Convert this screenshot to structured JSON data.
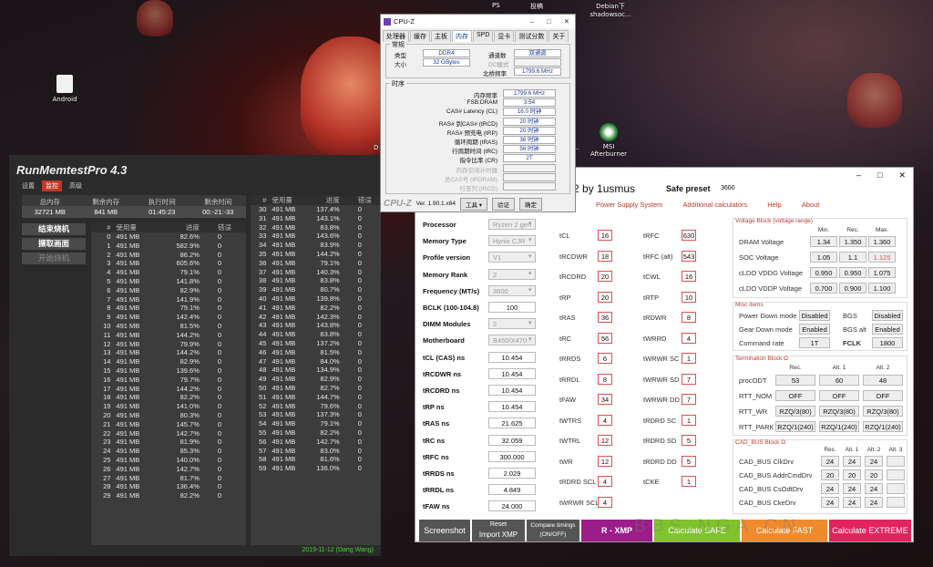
{
  "desktop": {
    "top_labels": [
      "PS",
      "投稿",
      "Debian下\nshadowsoc..."
    ],
    "icons": [
      {
        "label": "Android",
        "icon": "folder-icon"
      },
      {
        "label": "MSI\nAfterburner",
        "icon": "msi-icon"
      },
      {
        "label": "D",
        "icon": "app-icon"
      },
      {
        "label": "2...",
        "icon": "app-icon"
      }
    ]
  },
  "rmt": {
    "title": "RunMemtestPro 4.3",
    "menu": [
      "设置",
      "监控",
      "高级"
    ],
    "summary_headers": [
      "总内存",
      "剩余内存",
      "执行时间",
      "剩余时间"
    ],
    "summary_values": [
      "32721 MB",
      "841 MB",
      "01:45:23",
      "00:-21:-33"
    ],
    "buttons": [
      "结束烧机",
      "撷取画面",
      "开始烧机"
    ],
    "col_headers": [
      "#",
      "使用量",
      "进度",
      "错误"
    ],
    "left_rows": [
      [
        "0",
        "491 MB",
        "82.6%",
        "0"
      ],
      [
        "1",
        "491 MB",
        "582.9%",
        "0"
      ],
      [
        "2",
        "491 MB",
        "86.2%",
        "0"
      ],
      [
        "3",
        "491 MB",
        "605.6%",
        "0"
      ],
      [
        "4",
        "491 MB",
        "79.1%",
        "0"
      ],
      [
        "5",
        "491 MB",
        "141.8%",
        "0"
      ],
      [
        "6",
        "491 MB",
        "82.9%",
        "0"
      ],
      [
        "7",
        "491 MB",
        "141.9%",
        "0"
      ],
      [
        "8",
        "491 MB",
        "79.1%",
        "0"
      ],
      [
        "9",
        "491 MB",
        "142.4%",
        "0"
      ],
      [
        "10",
        "491 MB",
        "81.5%",
        "0"
      ],
      [
        "11",
        "491 MB",
        "144.2%",
        "0"
      ],
      [
        "12",
        "491 MB",
        "79.9%",
        "0"
      ],
      [
        "13",
        "491 MB",
        "144.2%",
        "0"
      ],
      [
        "14",
        "491 MB",
        "82.9%",
        "0"
      ],
      [
        "15",
        "491 MB",
        "139.6%",
        "0"
      ],
      [
        "16",
        "491 MB",
        "79.7%",
        "0"
      ],
      [
        "17",
        "491 MB",
        "144.2%",
        "0"
      ],
      [
        "18",
        "491 MB",
        "82.2%",
        "0"
      ],
      [
        "19",
        "491 MB",
        "141.0%",
        "0"
      ],
      [
        "20",
        "491 MB",
        "80.3%",
        "0"
      ],
      [
        "21",
        "491 MB",
        "145.7%",
        "0"
      ],
      [
        "22",
        "491 MB",
        "142.7%",
        "0"
      ],
      [
        "23",
        "491 MB",
        "81.9%",
        "0"
      ],
      [
        "24",
        "491 MB",
        "85.3%",
        "0"
      ],
      [
        "25",
        "491 MB",
        "140.0%",
        "0"
      ],
      [
        "26",
        "491 MB",
        "142.7%",
        "0"
      ],
      [
        "27",
        "491 MB",
        "81.7%",
        "0"
      ],
      [
        "28",
        "491 MB",
        "136.4%",
        "0"
      ],
      [
        "29",
        "491 MB",
        "82.2%",
        "0"
      ]
    ],
    "right_rows": [
      [
        "30",
        "491 MB",
        "137.4%",
        "0"
      ],
      [
        "31",
        "491 MB",
        "143.1%",
        "0"
      ],
      [
        "32",
        "491 MB",
        "83.8%",
        "0"
      ],
      [
        "33",
        "491 MB",
        "143.6%",
        "0"
      ],
      [
        "34",
        "491 MB",
        "83.9%",
        "0"
      ],
      [
        "35",
        "491 MB",
        "144.2%",
        "0"
      ],
      [
        "36",
        "491 MB",
        "79.1%",
        "0"
      ],
      [
        "37",
        "491 MB",
        "140.3%",
        "0"
      ],
      [
        "38",
        "491 MB",
        "83.8%",
        "0"
      ],
      [
        "39",
        "491 MB",
        "80.7%",
        "0"
      ],
      [
        "40",
        "491 MB",
        "139.8%",
        "0"
      ],
      [
        "41",
        "491 MB",
        "82.2%",
        "0"
      ],
      [
        "42",
        "491 MB",
        "142.3%",
        "0"
      ],
      [
        "43",
        "491 MB",
        "143.8%",
        "0"
      ],
      [
        "44",
        "491 MB",
        "83.8%",
        "0"
      ],
      [
        "45",
        "491 MB",
        "137.2%",
        "0"
      ],
      [
        "46",
        "491 MB",
        "81.5%",
        "0"
      ],
      [
        "47",
        "491 MB",
        "84.0%",
        "0"
      ],
      [
        "48",
        "491 MB",
        "134.9%",
        "0"
      ],
      [
        "49",
        "491 MB",
        "82.9%",
        "0"
      ],
      [
        "50",
        "491 MB",
        "82.7%",
        "0"
      ],
      [
        "51",
        "491 MB",
        "144.7%",
        "0"
      ],
      [
        "52",
        "491 MB",
        "79.6%",
        "0"
      ],
      [
        "53",
        "491 MB",
        "137.3%",
        "0"
      ],
      [
        "54",
        "491 MB",
        "79.1%",
        "0"
      ],
      [
        "55",
        "491 MB",
        "82.2%",
        "0"
      ],
      [
        "56",
        "491 MB",
        "142.7%",
        "0"
      ],
      [
        "57",
        "491 MB",
        "83.0%",
        "0"
      ],
      [
        "58",
        "491 MB",
        "81.6%",
        "0"
      ],
      [
        "59",
        "491 MB",
        "136.0%",
        "0"
      ]
    ],
    "date": "2019-11-12 (Dang Wang)"
  },
  "cpuz": {
    "title": "CPU-Z",
    "tabs": [
      "处理器",
      "缓存",
      "主板",
      "内存",
      "SPD",
      "显卡",
      "测试分数",
      "关于"
    ],
    "active_tab": "内存",
    "general_title": "常规",
    "type_label": "类型",
    "type": "DDR4",
    "size_label": "大小",
    "size": "32 GBytes",
    "channels_label": "通道数",
    "channels": "双通道",
    "dcmode_label": "DC模式",
    "dcmode": "",
    "nb_label": "北桥频率",
    "nb": "1799.6 MHz",
    "timing_title": "时序",
    "timings": [
      {
        "k": "内存频率",
        "v": "1799.6 MHz"
      },
      {
        "k": "FSB:DRAM",
        "v": "3:54"
      },
      {
        "k": "CAS# Latency (CL)",
        "v": "16.0 时钟"
      },
      {
        "k": "RAS# 到CAS# (tRCD)",
        "v": "20 时钟"
      },
      {
        "k": "RAS# 预充电 (tRP)",
        "v": "20 时钟"
      },
      {
        "k": "循环周期 (tRAS)",
        "v": "36 时钟"
      },
      {
        "k": "行周期时间 (tRC)",
        "v": "56 时钟"
      },
      {
        "k": "指令比率 (CR)",
        "v": "2T"
      },
      {
        "k": "内存空闲计时器",
        "v": ""
      },
      {
        "k": "总CAS号 (tRDRAM)",
        "v": ""
      },
      {
        "k": "行至列 (tRCD)",
        "v": ""
      }
    ],
    "footer": {
      "logo": "CPU-Z",
      "ver": "Ver. 1.90.1.x64",
      "tools": "工具",
      "validate": "验证",
      "ok": "确定"
    }
  },
  "dc": {
    "title": "6.2 by 1usmus",
    "safe_label": "Safe preset",
    "safe_value": "3600",
    "nav": [
      "Power Supply System",
      "Additional calculators",
      "Help",
      "About"
    ],
    "left_fields": [
      {
        "k": "Processor",
        "v": "Ryzen 2 gen",
        "g": true
      },
      {
        "k": "Memory Type",
        "v": "Hynix CJR",
        "g": true
      },
      {
        "k": "Profile version",
        "v": "V1",
        "g": true
      },
      {
        "k": "Memory Rank",
        "v": "2",
        "g": true
      },
      {
        "k": "Frequency (MT/s)",
        "v": "3600",
        "g": true
      },
      {
        "k": "BCLK (100-104.8)",
        "v": "100",
        "g": false
      },
      {
        "k": "DIMM Modules",
        "v": "2",
        "g": true
      },
      {
        "k": "Motherboard",
        "v": "B450/X470",
        "g": true
      },
      {
        "k": "tCL (CAS) ns",
        "v": "10.454",
        "g": false
      },
      {
        "k": "tRCDWR ns",
        "v": "10.454",
        "g": false
      },
      {
        "k": "tRCDRD ns",
        "v": "10.454",
        "g": false
      },
      {
        "k": "tRP ns",
        "v": "10.454",
        "g": false
      },
      {
        "k": "tRAS ns",
        "v": "21.625",
        "g": false
      },
      {
        "k": "tRC ns",
        "v": "32.059",
        "g": false
      },
      {
        "k": "tRFC ns",
        "v": "300.000",
        "g": false
      },
      {
        "k": "tRRDS ns",
        "v": "2.029",
        "g": false
      },
      {
        "k": "tRRDL ns",
        "v": "4.849",
        "g": false
      },
      {
        "k": "tFAW ns",
        "v": "24.000",
        "g": false
      }
    ],
    "mid1": [
      {
        "k": "tCL",
        "v": "16"
      },
      {
        "k": "tRCDWR",
        "v": "18"
      },
      {
        "k": "tRCDRD",
        "v": "20"
      },
      {
        "k": "tRP",
        "v": "20"
      },
      {
        "k": "tRAS",
        "v": "36"
      },
      {
        "k": "tRC",
        "v": "56"
      },
      {
        "k": "tRRDS",
        "v": "6"
      },
      {
        "k": "tRRDL",
        "v": "8"
      },
      {
        "k": "tFAW",
        "v": "34"
      },
      {
        "k": "tWTRS",
        "v": "4"
      },
      {
        "k": "tWTRL",
        "v": "12"
      },
      {
        "k": "tWR",
        "v": "12"
      },
      {
        "k": "tRDRD SCL",
        "v": "4"
      },
      {
        "k": "tWRWR SCL",
        "v": "4"
      }
    ],
    "mid2": [
      {
        "k": "tRFC",
        "v": "630"
      },
      {
        "k": "tRFC (alt)",
        "v": "543"
      },
      {
        "k": "tCWL",
        "v": "16"
      },
      {
        "k": "tRTP",
        "v": "10"
      },
      {
        "k": "tRDWR",
        "v": "8"
      },
      {
        "k": "tWRRD",
        "v": "4"
      },
      {
        "k": "tWRWR SC",
        "v": "1"
      },
      {
        "k": "tWRWR SD",
        "v": "7"
      },
      {
        "k": "tWRWR DD",
        "v": "7"
      },
      {
        "k": "tRDRD SC",
        "v": "1"
      },
      {
        "k": "tRDRD SD",
        "v": "5"
      },
      {
        "k": "tRDRD DD",
        "v": "5"
      },
      {
        "k": "tCKE",
        "v": "1"
      }
    ],
    "voltage": {
      "title": "Voltage Block (voltage range)",
      "cols": [
        "Min.",
        "Rec.",
        "Max."
      ],
      "rows": [
        {
          "k": "DRAM Voltage",
          "v": [
            "1.34",
            "1.350",
            "1.360"
          ]
        },
        {
          "k": "SOC Voltage",
          "v": [
            "1.05",
            "1.1",
            "1.125"
          ]
        },
        {
          "k": "cLDO VDDG Voltage",
          "v": [
            "0.950",
            "0.950",
            "1.075"
          ]
        },
        {
          "k": "cLDO VDDP Voltage",
          "v": [
            "0.700",
            "0.900",
            "1.100"
          ]
        }
      ]
    },
    "misc": {
      "title": "Misc items",
      "rows": [
        [
          "Power Down mode",
          "Disabled",
          "BGS",
          "Disabled"
        ],
        [
          "Gear Down mode",
          "Enabled",
          "BGS alt",
          "Enabled"
        ],
        [
          "Command rate",
          "1T",
          "FCLK",
          "1800"
        ]
      ]
    },
    "term": {
      "title": "Termination Block Ω",
      "cols": [
        "Rec.",
        "Alt. 1",
        "Alt. 2"
      ],
      "rows": [
        {
          "k": "procODT",
          "v": [
            "53",
            "60",
            "48"
          ]
        },
        {
          "k": "RTT_NOM",
          "v": [
            "OFF",
            "OFF",
            "OFF"
          ]
        },
        {
          "k": "RTT_WR",
          "v": [
            "RZQ/3(80)",
            "RZQ/3(80)",
            "RZQ/3(80)"
          ]
        },
        {
          "k": "RTT_PARK",
          "v": [
            "RZQ/1(240)",
            "RZQ/1(240)",
            "RZQ/1(240)"
          ]
        }
      ]
    },
    "cad": {
      "title": "CAD_BUS Block Ω",
      "cols": [
        "Rec.",
        "Alt. 1",
        "Alt. 2",
        "Alt. 3"
      ],
      "rows": [
        {
          "k": "CAD_BUS ClkDrv",
          "v": [
            "24",
            "24",
            "24",
            ""
          ]
        },
        {
          "k": "CAD_BUS AddrCmdDrv",
          "v": [
            "20",
            "20",
            "20",
            ""
          ]
        },
        {
          "k": "CAD_BUS CsOdtDrv",
          "v": [
            "24",
            "24",
            "24",
            ""
          ]
        },
        {
          "k": "CAD_BUS CkeDrv",
          "v": [
            "24",
            "24",
            "24",
            ""
          ]
        }
      ]
    },
    "bottom": {
      "screenshot": "Screenshot",
      "reset": "Reset",
      "import": "Import XMP",
      "compare": "Compare timings\n(ON/OFF)",
      "rxmp": "R - XMP",
      "safe": "Calculate SAFE",
      "fast": "Calculate FAST",
      "extreme": "Calculate EXTREME"
    },
    "watermark": "BBS.NGA.CN"
  },
  "colors": {
    "safe": "#7fc42a",
    "fast": "#f08b2d",
    "extreme": "#e0245e",
    "rxmp": "#9b1d8a"
  }
}
